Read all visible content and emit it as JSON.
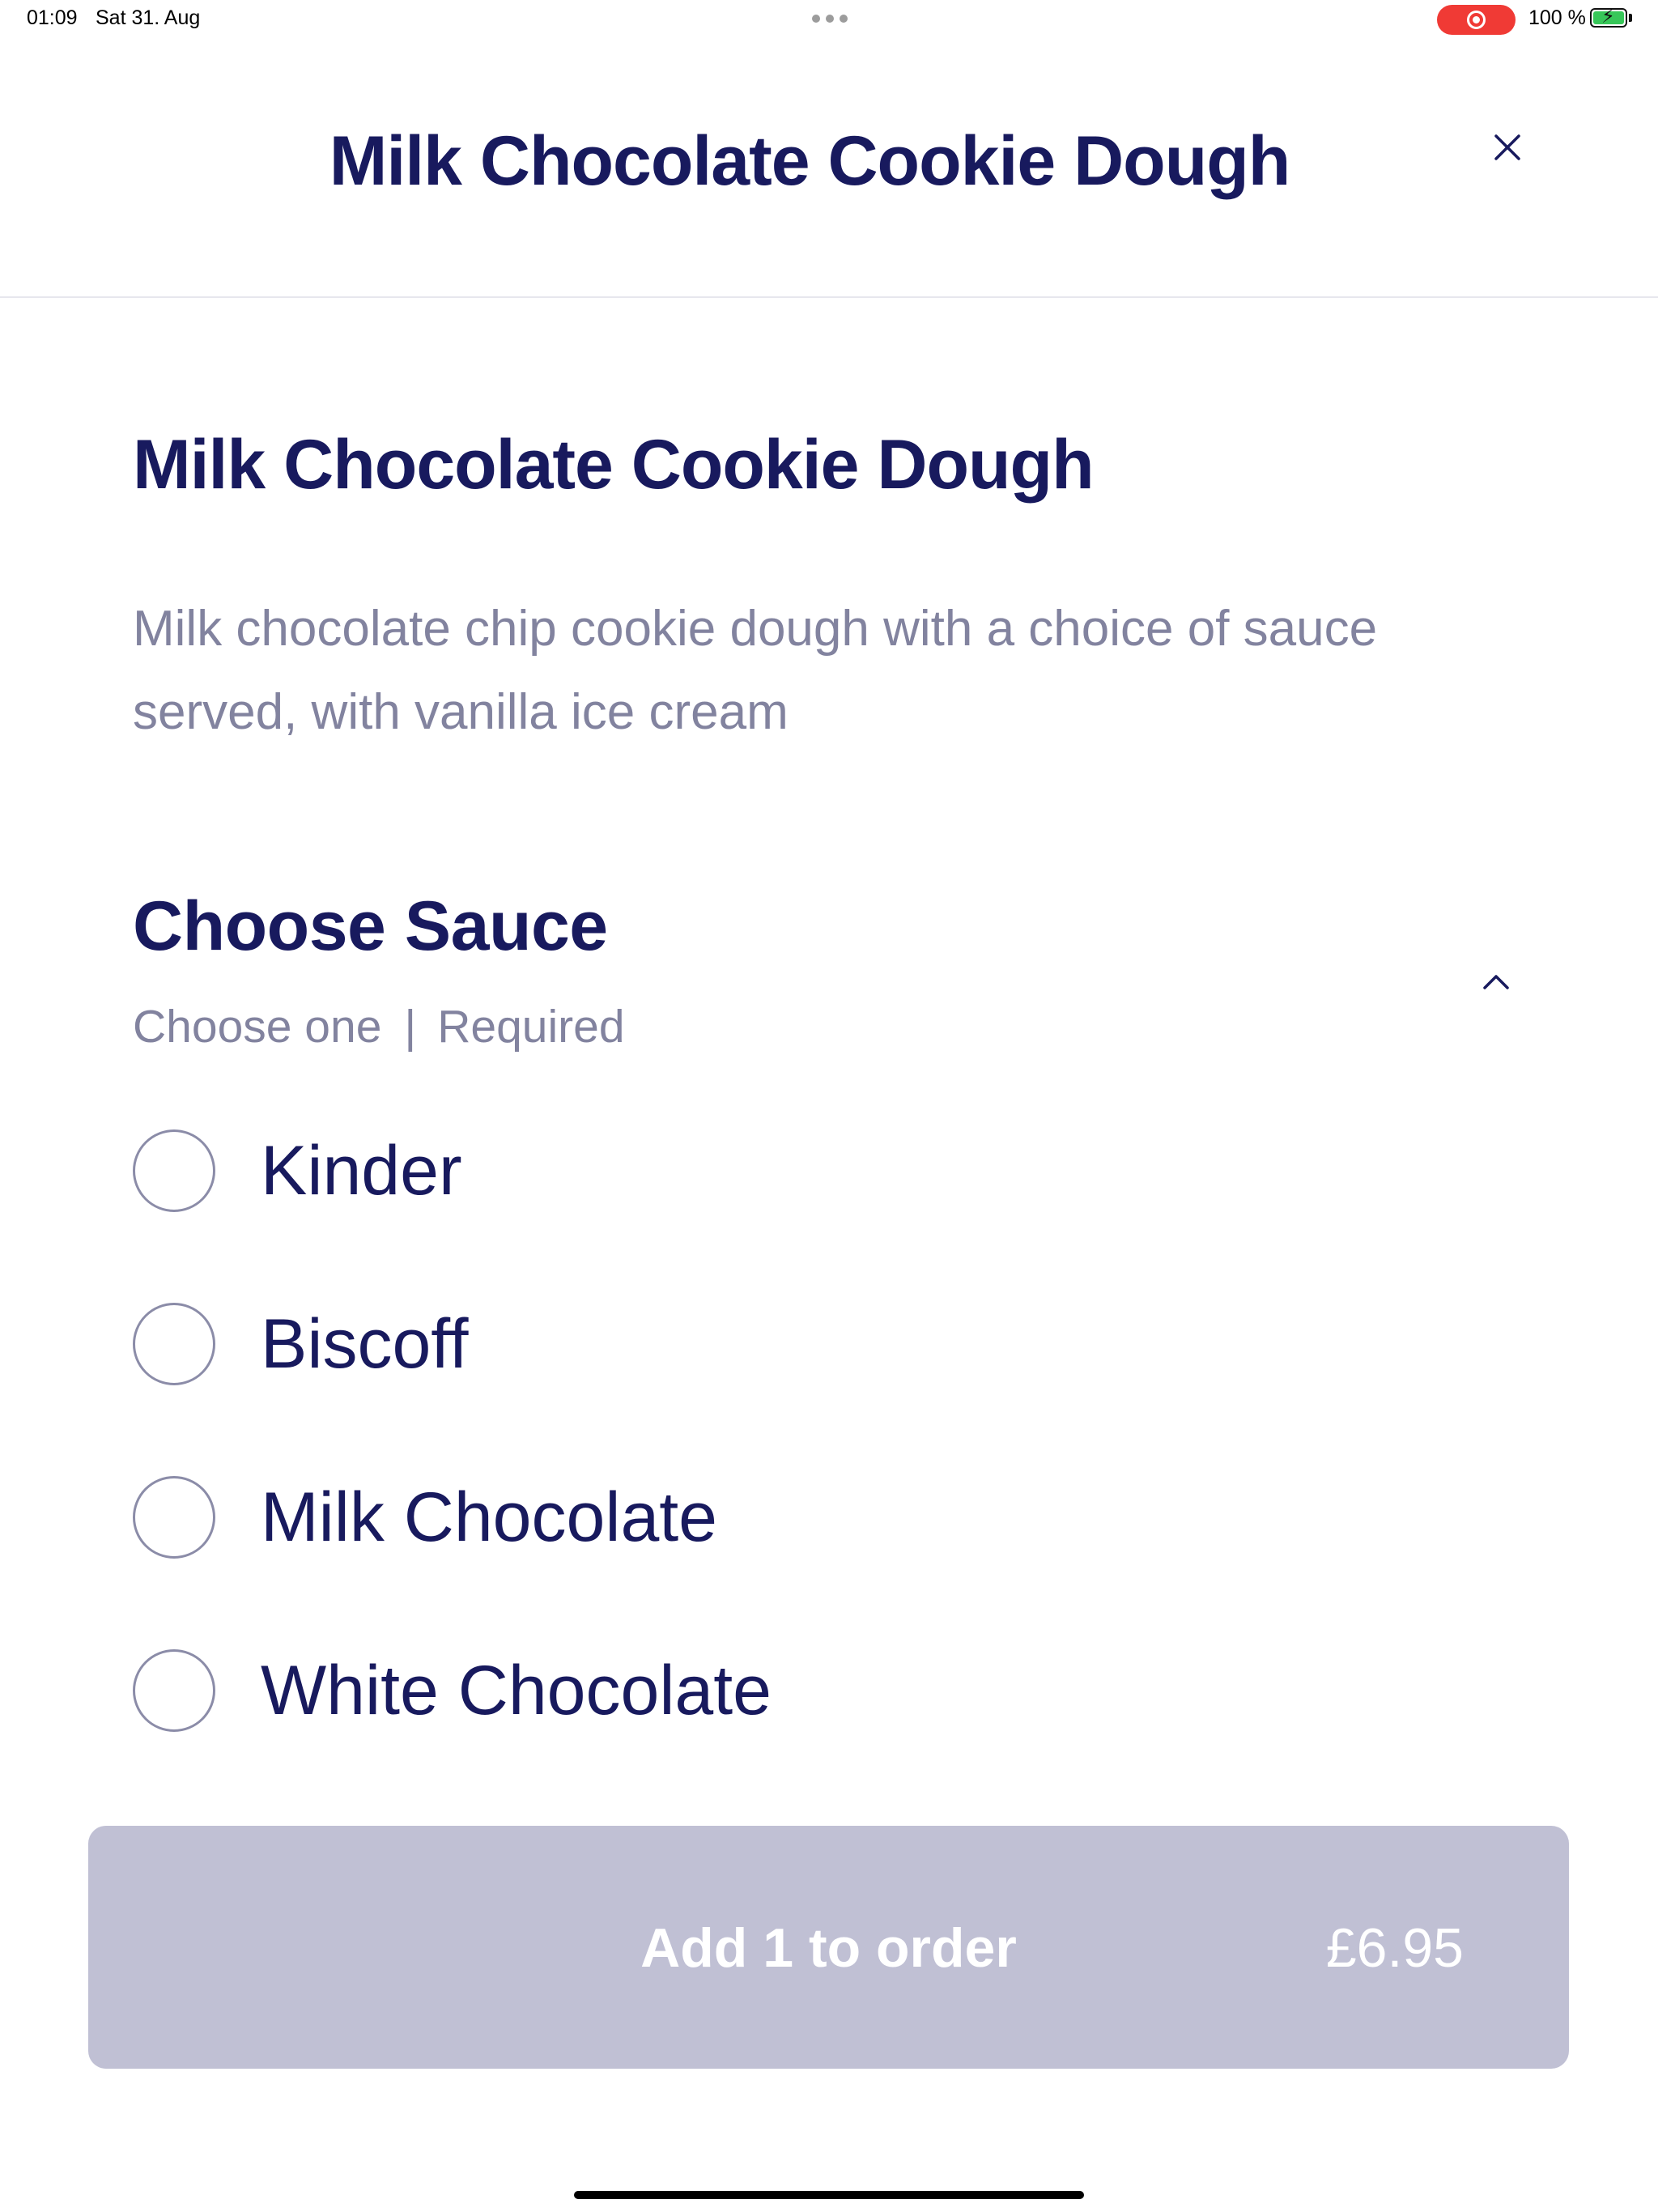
{
  "status_bar": {
    "time": "01:09",
    "date": "Sat 31. Aug",
    "battery_percent": "100 %",
    "recording_color": "#f03a35",
    "battery_color": "#37c759"
  },
  "header": {
    "title": "Milk Chocolate Cookie Dough",
    "close_icon": "close-icon"
  },
  "item": {
    "title": "Milk Chocolate Cookie Dough",
    "description": "Milk chocolate chip cookie dough with a choice of sauce served, with vanilla ice cream"
  },
  "sauce_section": {
    "title": "Choose Sauce",
    "choose_text": "Choose one",
    "separator": "|",
    "required_text": "Required",
    "collapse_icon": "chevron-up-icon",
    "options": [
      {
        "label": "Kinder",
        "selected": false
      },
      {
        "label": "Biscoff",
        "selected": false
      },
      {
        "label": "Milk Chocolate",
        "selected": false
      },
      {
        "label": "White Chocolate",
        "selected": false
      }
    ]
  },
  "order_button": {
    "label": "Add 1 to order",
    "price": "£6.95",
    "disabled": true,
    "background": "#c0c0d4"
  },
  "colors": {
    "primary_text": "#181a5e",
    "secondary_text": "#82839f"
  }
}
